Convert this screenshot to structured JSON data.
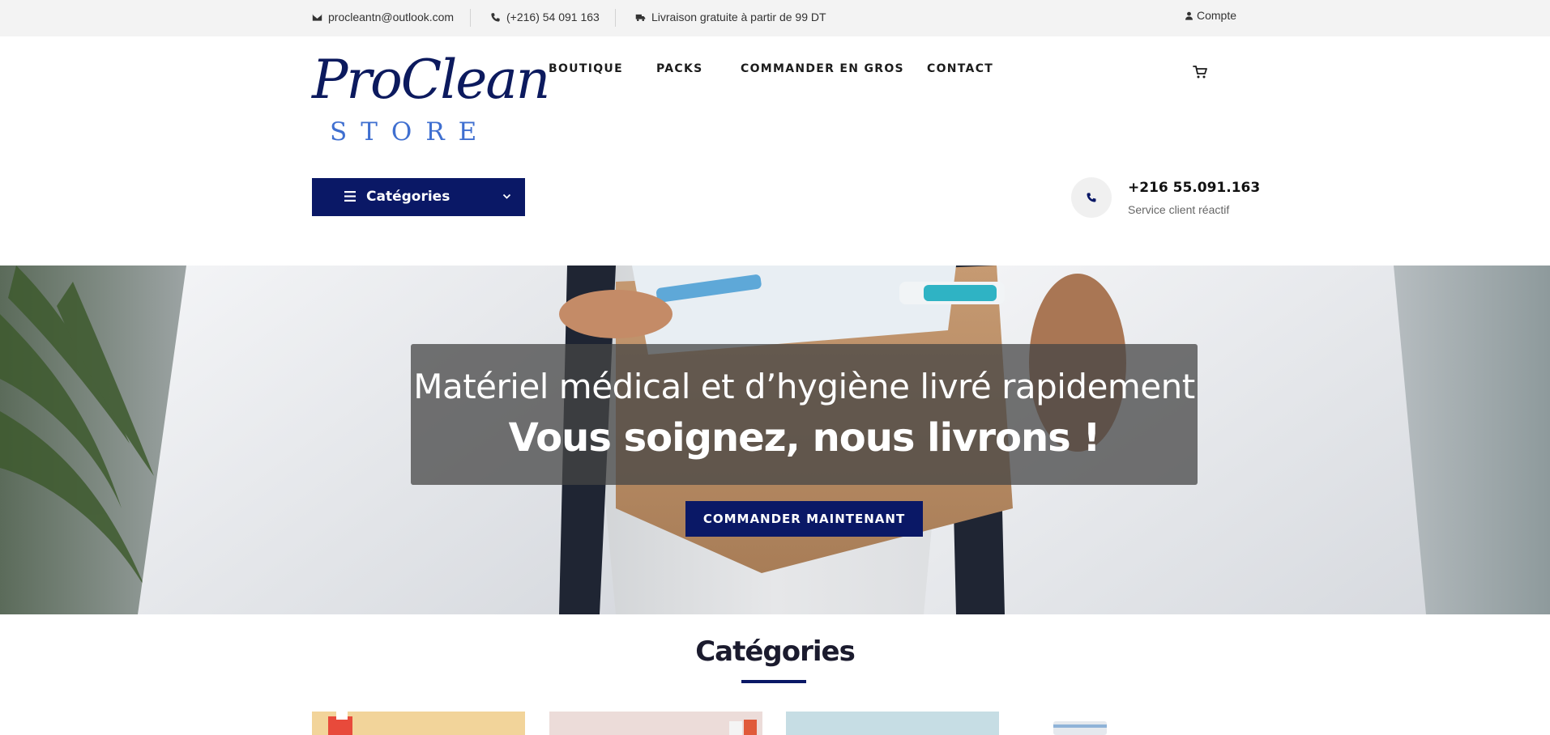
{
  "topbar": {
    "email": "procleantn@outlook.com",
    "phone": "(+216) 54 091 163",
    "shipping": "Livraison gratuite à partir de 99 DT",
    "account": "Compte"
  },
  "logo": {
    "line1": "ProClean",
    "line2": "STORE"
  },
  "nav": {
    "items": [
      {
        "label": "BOUTIQUE"
      },
      {
        "label": "PACKS"
      },
      {
        "label": "COMMANDER EN GROS"
      },
      {
        "label": "CONTACT"
      }
    ]
  },
  "categories_button": {
    "label": "Catégories"
  },
  "support": {
    "phone": "+216 55.091.163",
    "subtitle": "Service client réactif"
  },
  "hero": {
    "title": "Matériel médical et d’hygiène livré rapidement",
    "subtitle": "Vous soignez, nous livrons !",
    "cta": "COMMANDER MAINTENANT"
  },
  "section": {
    "title": "Catégories"
  },
  "colors": {
    "brand": "#0a1866",
    "accent": "#3f6fd0",
    "topbar": "#f3f3f3"
  },
  "icons": [
    "envelope-icon",
    "phone-icon",
    "truck-icon",
    "user-icon",
    "cart-icon",
    "menu-icon",
    "chevron-down-icon"
  ]
}
